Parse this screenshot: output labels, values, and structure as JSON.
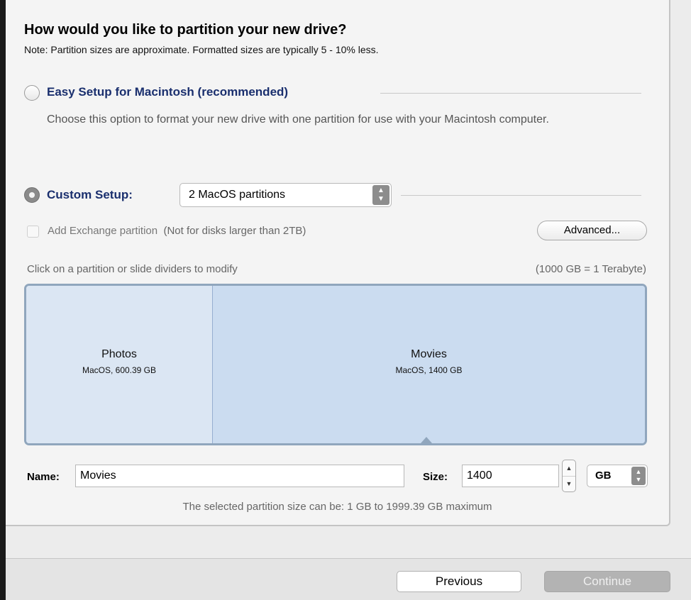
{
  "header": {
    "title": "How would you like to partition your new drive?",
    "note": "Note: Partition sizes are approximate.  Formatted sizes are typically 5 - 10% less."
  },
  "easy_setup": {
    "label": "Easy Setup for Macintosh (recommended)",
    "description": "Choose this option to format your new drive with one partition for use with your Macintosh computer.",
    "selected": false
  },
  "custom_setup": {
    "label": "Custom Setup:",
    "selected": true,
    "scheme_value": "2 MacOS partitions"
  },
  "exchange": {
    "label": "Add Exchange partition",
    "note": "(Not for disks larger than 2TB)",
    "checked": false
  },
  "advanced_button": "Advanced...",
  "instructions": "Click on a partition or slide dividers to modify",
  "terabyte_note": "(1000 GB = 1 Terabyte)",
  "partitions": [
    {
      "name": "Photos",
      "info": "MacOS, 600.39 GB",
      "size_gb": 600.39
    },
    {
      "name": "Movies",
      "info": "MacOS, 1400 GB",
      "size_gb": 1400,
      "selected": true
    }
  ],
  "editor": {
    "name_label": "Name:",
    "name_value": "Movies",
    "size_label": "Size:",
    "size_value": "1400",
    "unit_value": "GB",
    "range_text": "The selected partition size can be: 1 GB to 1999.39 GB maximum"
  },
  "footer": {
    "previous_label": "Previous",
    "continue_label": "Continue"
  }
}
